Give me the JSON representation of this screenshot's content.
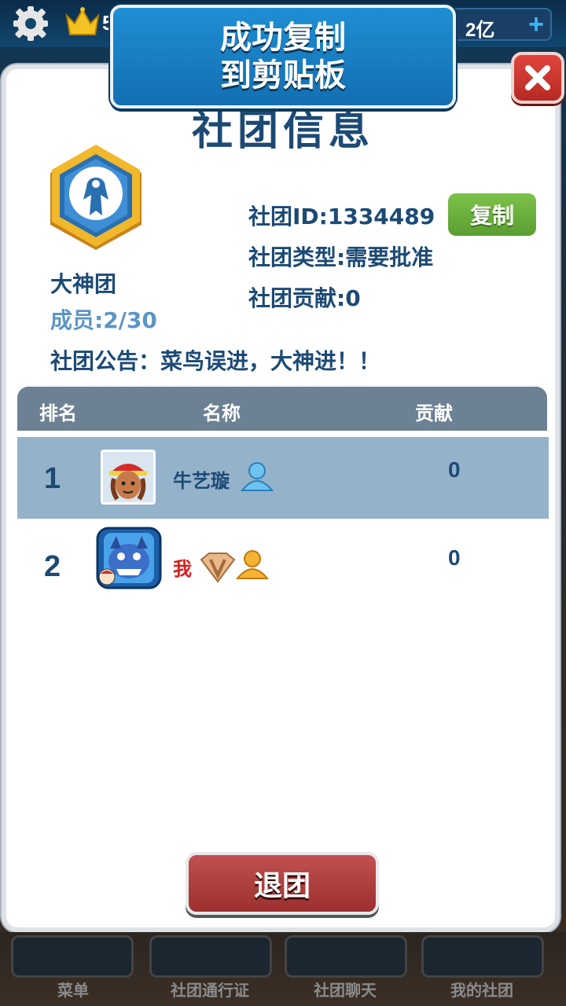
{
  "hud": {
    "crown_value": "5",
    "coins": "2亿",
    "plus": "+"
  },
  "toast": {
    "line1": "成功复制",
    "line2": "到剪贴板"
  },
  "panel": {
    "title": "社团信息"
  },
  "club": {
    "name": "大神团",
    "members": "成员:2/30",
    "id_line": "社团ID:1334489",
    "type_line": "社团类型:需要批准",
    "contribution_line": "社团贡献:0",
    "copy_label": "复制",
    "notice": "社团公告：菜鸟误进，大神进！！"
  },
  "table": {
    "headers": [
      "排名",
      "名称",
      "贡献"
    ],
    "rows": [
      {
        "rank": "1",
        "name": "牛艺璇",
        "contribution": "0",
        "selected": true
      },
      {
        "rank": "2",
        "name": "我",
        "contribution": "0",
        "selected": false
      }
    ]
  },
  "quit_label": "退团",
  "bottom_nav": [
    {
      "label": "菜单",
      "icon": "back-arrow-icon"
    },
    {
      "label": "社团通行证",
      "icon": "pass-icon"
    },
    {
      "label": "社团聊天",
      "icon": "chat-icon"
    },
    {
      "label": "我的社团",
      "icon": "flag-icon"
    }
  ],
  "colors": {
    "accent_blue": "#1c4a75",
    "toast_blue": "#1f8ed3",
    "copy_green": "#6cb23e",
    "quit_red": "#b03c3c",
    "close_red": "#d23a32"
  }
}
